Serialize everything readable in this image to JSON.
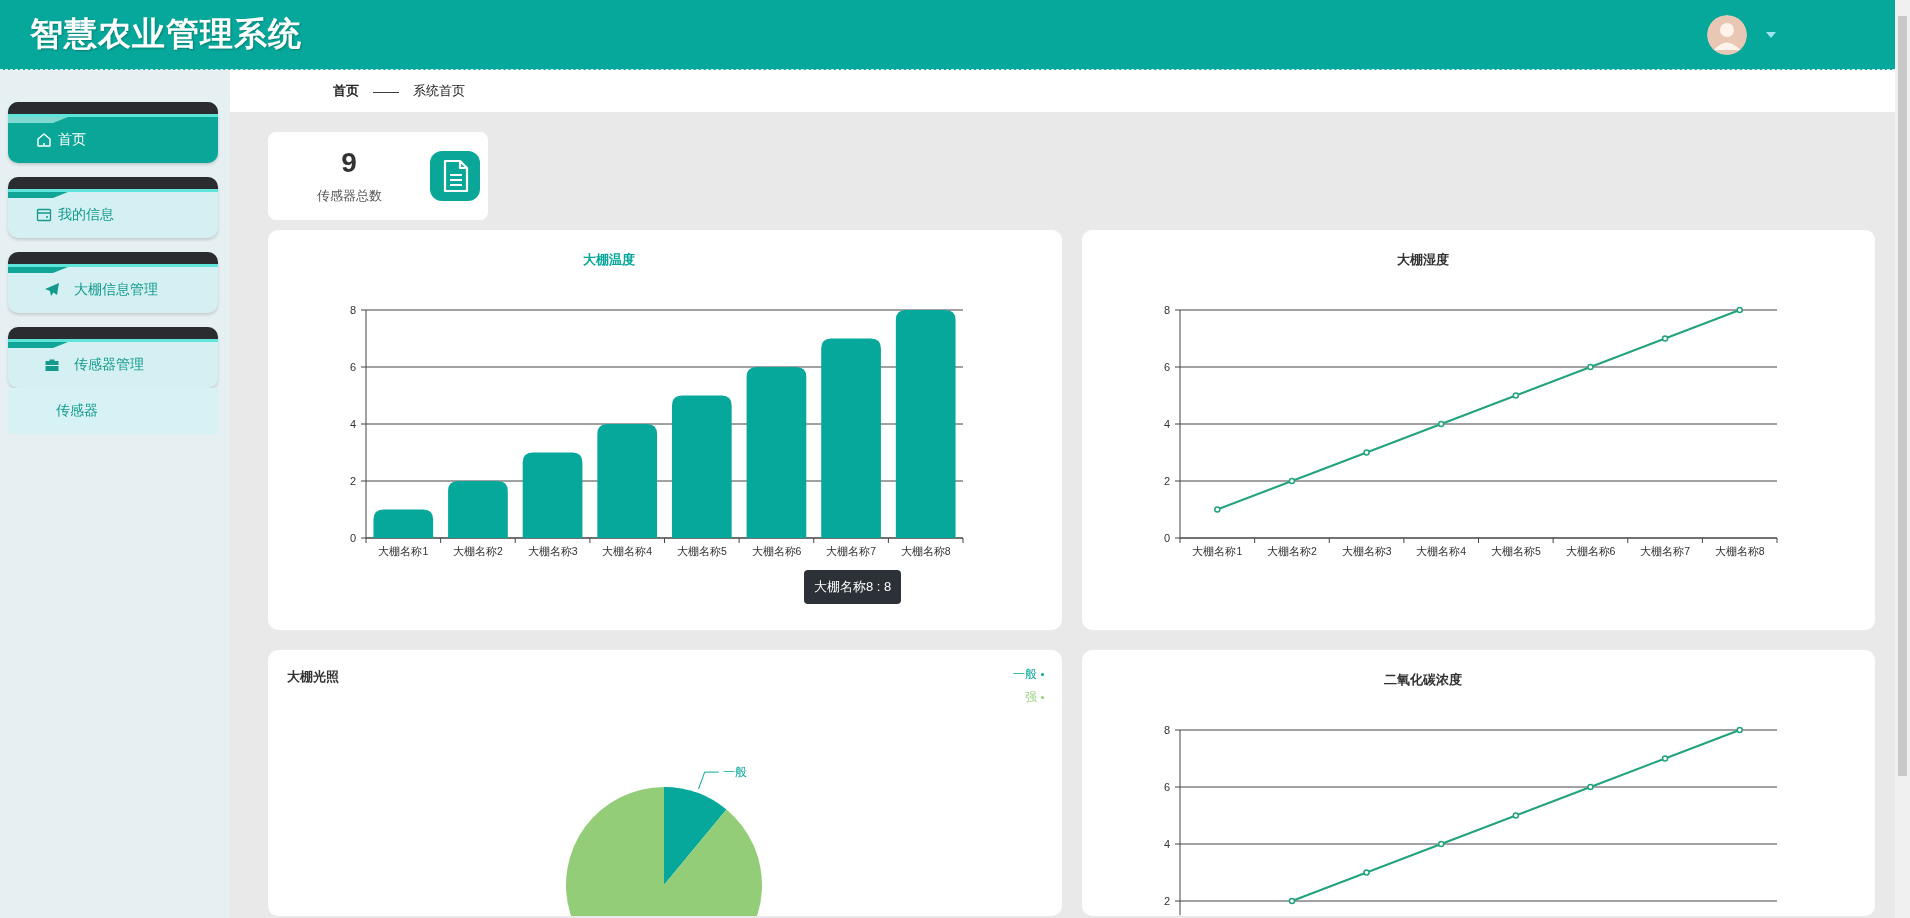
{
  "header": {
    "title": "智慧农业管理系统"
  },
  "sidebar": {
    "items": [
      {
        "label": "首页",
        "selected": true
      },
      {
        "label": "我的信息",
        "selected": false
      },
      {
        "label": "大棚信息管理",
        "selected": false
      },
      {
        "label": "传感器管理",
        "selected": false,
        "expanded": true,
        "children": [
          {
            "label": "传感器",
            "selected": false
          }
        ]
      }
    ]
  },
  "breadcrumb": [
    "首页",
    "——",
    "系统首页"
  ],
  "stats": [
    {
      "value": "9",
      "label": "传感器总数"
    }
  ],
  "charts": [
    {
      "tooltip": "大棚名称8 : 8",
      "chart_data": {
        "type": "bar",
        "title": "大棚温度",
        "grid": true,
        "categories": [
          "大棚名称1",
          "大棚名称2",
          "大棚名称3",
          "大棚名称4",
          "大棚名称5",
          "大棚名称6",
          "大棚名称7",
          "大棚名称8"
        ],
        "ylim": [
          0,
          8
        ],
        "yticks": [
          0,
          2,
          4,
          6,
          8
        ],
        "series": [
          {
            "color": "#05a89a",
            "values": [
              1,
              2,
              3,
              4,
              5,
              6,
              7,
              8
            ]
          }
        ]
      }
    },
    {
      "chart_data": {
        "type": "line",
        "title": "大棚湿度",
        "grid": true,
        "categories": [
          "大棚名称1",
          "大棚名称2",
          "大棚名称3",
          "大棚名称4",
          "大棚名称5",
          "大棚名称6",
          "大棚名称7",
          "大棚名称8"
        ],
        "ylim": [
          0,
          8
        ],
        "yticks": [
          0,
          2,
          4,
          6,
          8
        ],
        "series": [
          {
            "color": "#22a37d",
            "marker": true,
            "values": [
              1,
              2,
              3,
              4,
              5,
              6,
              7,
              8
            ]
          }
        ]
      }
    },
    {
      "slices": [
        {
          "label": "一般",
          "color": "#05a89a"
        },
        {
          "color": "#93cd77"
        }
      ],
      "chart_data": {
        "type": "pie",
        "title": "大棚光照",
        "categories": [
          "一般",
          "强"
        ],
        "series": [
          {
            "values": [
              11,
              89
            ]
          }
        ]
      }
    },
    {
      "chart_data": {
        "type": "line",
        "title": "二氧化碳浓度",
        "grid": true,
        "ylim": [
          1.5,
          8
        ],
        "yticks": [
          2,
          4,
          6,
          8
        ],
        "series": [
          {
            "color": "#22a37d",
            "marker": true,
            "values": [
              null,
              2,
              3,
              4,
              5,
              6,
              7,
              8
            ]
          }
        ]
      }
    }
  ]
}
